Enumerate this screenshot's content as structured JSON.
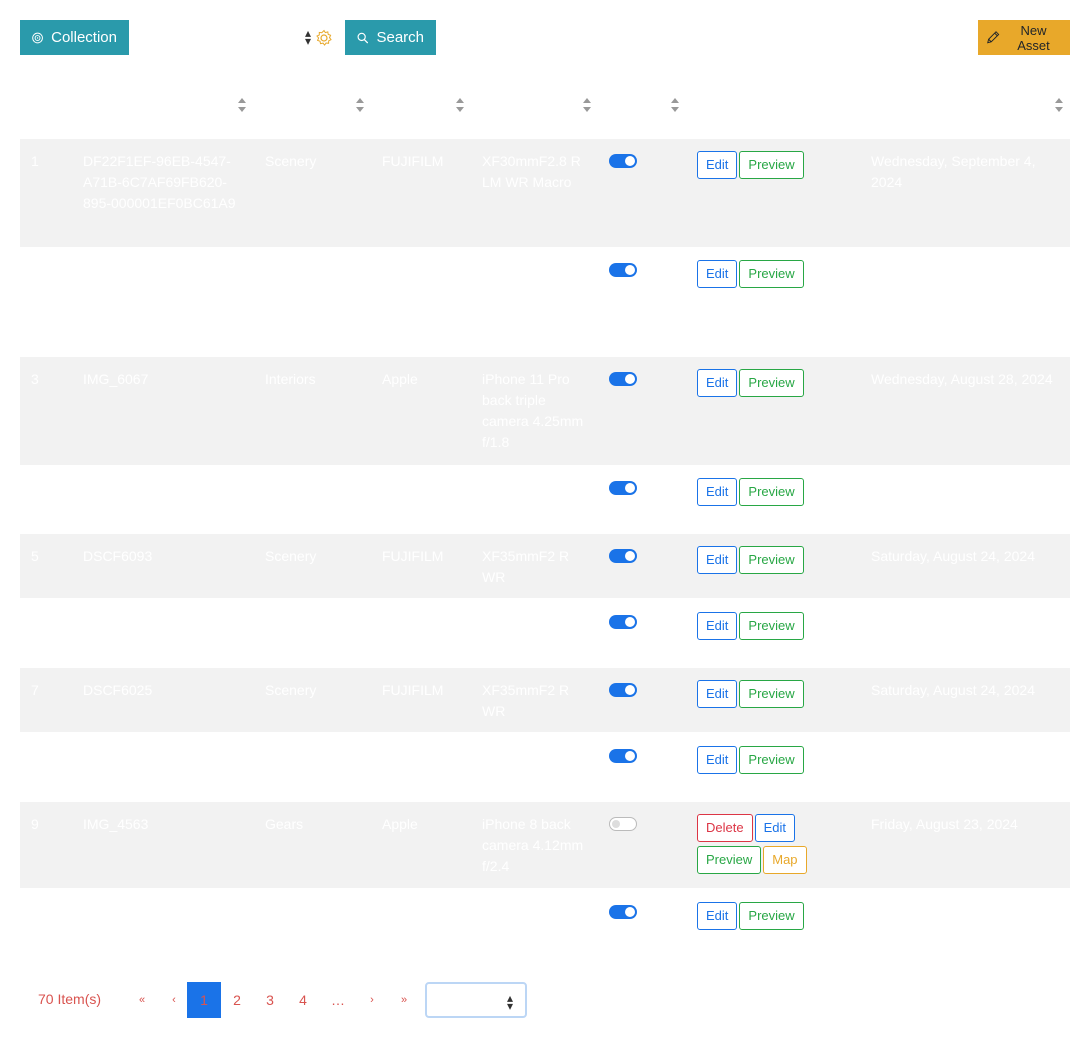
{
  "toolbar": {
    "collection_label": "Collection",
    "collection_value": "",
    "search_label": "Search",
    "new_asset_label": "New Asset",
    "icons": {
      "collection": "target-icon",
      "settings": "gear-icon",
      "search": "search-icon",
      "new": "pencil-icon"
    }
  },
  "rows": [
    {
      "num": "1",
      "name": "DF22F1EF-96EB-4547-A71B-6C7AF69FB620-895-000001EF0BC61A9",
      "category": "Scenery",
      "make": "FUJIFILM",
      "lens": "XF30mmF2.8 R LM WR Macro",
      "published": true,
      "actions": [
        "Edit",
        "Preview"
      ],
      "date": "Wednesday, September 4, 2024"
    },
    {
      "num": "",
      "name": "",
      "category": "",
      "make": "",
      "lens": "",
      "published": true,
      "actions": [
        "Edit",
        "Preview"
      ],
      "date": ""
    },
    {
      "num": "3",
      "name": "IMG_6067",
      "category": "Interiors",
      "make": "Apple",
      "lens": "iPhone 11 Pro back triple camera 4.25mm f/1.8",
      "published": true,
      "actions": [
        "Edit",
        "Preview"
      ],
      "date": "Wednesday, August 28, 2024"
    },
    {
      "num": "",
      "name": "",
      "category": "",
      "make": "",
      "lens": "",
      "published": true,
      "actions": [
        "Edit",
        "Preview"
      ],
      "date": ""
    },
    {
      "num": "5",
      "name": "DSCF6093",
      "category": "Scenery",
      "make": "FUJIFILM",
      "lens": "XF35mmF2 R WR",
      "published": true,
      "actions": [
        "Edit",
        "Preview"
      ],
      "date": "Saturday, August 24, 2024"
    },
    {
      "num": "",
      "name": "",
      "category": "",
      "make": "",
      "lens": "",
      "published": true,
      "actions": [
        "Edit",
        "Preview"
      ],
      "date": ""
    },
    {
      "num": "7",
      "name": "DSCF6025",
      "category": "Scenery",
      "make": "FUJIFILM",
      "lens": "XF35mmF2 R WR",
      "published": true,
      "actions": [
        "Edit",
        "Preview"
      ],
      "date": "Saturday, August 24, 2024"
    },
    {
      "num": "",
      "name": "",
      "category": "",
      "make": "",
      "lens": "",
      "published": true,
      "actions": [
        "Edit",
        "Preview"
      ],
      "date": ""
    },
    {
      "num": "9",
      "name": "IMG_4563",
      "category": "Gears",
      "make": "Apple",
      "lens": "iPhone 8 back camera 4.12mm f/2.4",
      "published": false,
      "actions": [
        "Delete",
        "Edit",
        "Preview",
        "Map"
      ],
      "date": "Friday, August 23, 2024"
    },
    {
      "num": "",
      "name": "",
      "category": "",
      "make": "",
      "lens": "",
      "published": true,
      "actions": [
        "Edit",
        "Preview"
      ],
      "date": ""
    }
  ],
  "pagination": {
    "count_label": "70 Item(s)",
    "first": "«",
    "prev": "‹",
    "pages": [
      "1",
      "2",
      "3",
      "4"
    ],
    "current_page": "1",
    "ellipsis": "…",
    "next": "›",
    "last": "»",
    "page_size_value": ""
  },
  "colors": {
    "primary": "#2a9aab",
    "warning": "#e8a82a",
    "link": "#1a73e8",
    "success": "#28a745",
    "danger": "#dc3545"
  }
}
